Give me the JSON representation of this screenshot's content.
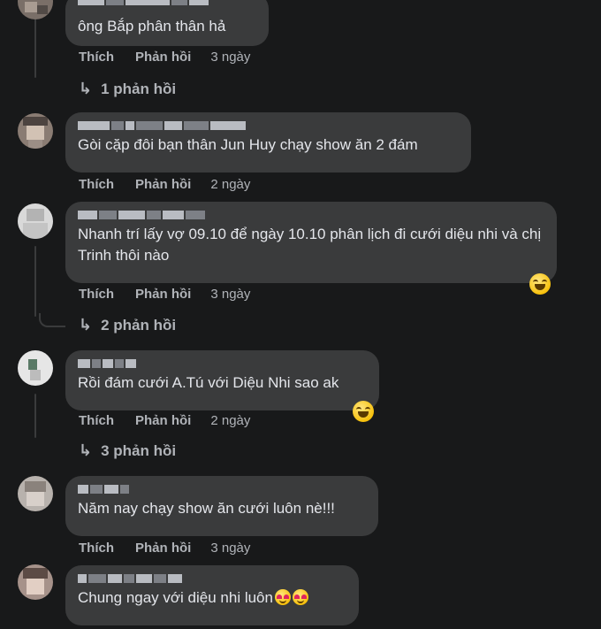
{
  "labels": {
    "like": "Thích",
    "reply": "Phản hồi"
  },
  "comments": [
    {
      "text": "ông Bắp phân thân hả",
      "time": "3 ngày",
      "replies": "1 phản hồi"
    },
    {
      "text": "Gòi cặp đôi bạn thân Jun Huy chạy show ăn 2 đám",
      "time": "2 ngày",
      "replies": ""
    },
    {
      "text": "Nhanh trí lấy vợ 09.10 để ngày 10.10 phân lịch đi cưới diệu nhi và chị Trinh thôi nào",
      "time": "3 ngày",
      "replies": "2 phản hồi",
      "reaction_icon": "grinning-squinting-face-icon"
    },
    {
      "text": "Rồi đám cưới A.Tú với Diệu Nhi sao ak",
      "time": "2 ngày",
      "replies": "3 phản hồi",
      "reaction_icon": "grinning-squinting-face-icon"
    },
    {
      "text": "Năm nay chạy show ăn cưới luôn nè!!!",
      "time": "3 ngày",
      "replies": ""
    },
    {
      "text": "Chung ngay với diệu nhi luôn",
      "time": "",
      "replies": "",
      "inline_icon": "smiling-face-with-hearts-icon"
    }
  ],
  "colors": {
    "background": "#18191a",
    "bubble": "#3a3b3c",
    "text": "#e4e6eb",
    "secondary": "#b0b3b8"
  }
}
